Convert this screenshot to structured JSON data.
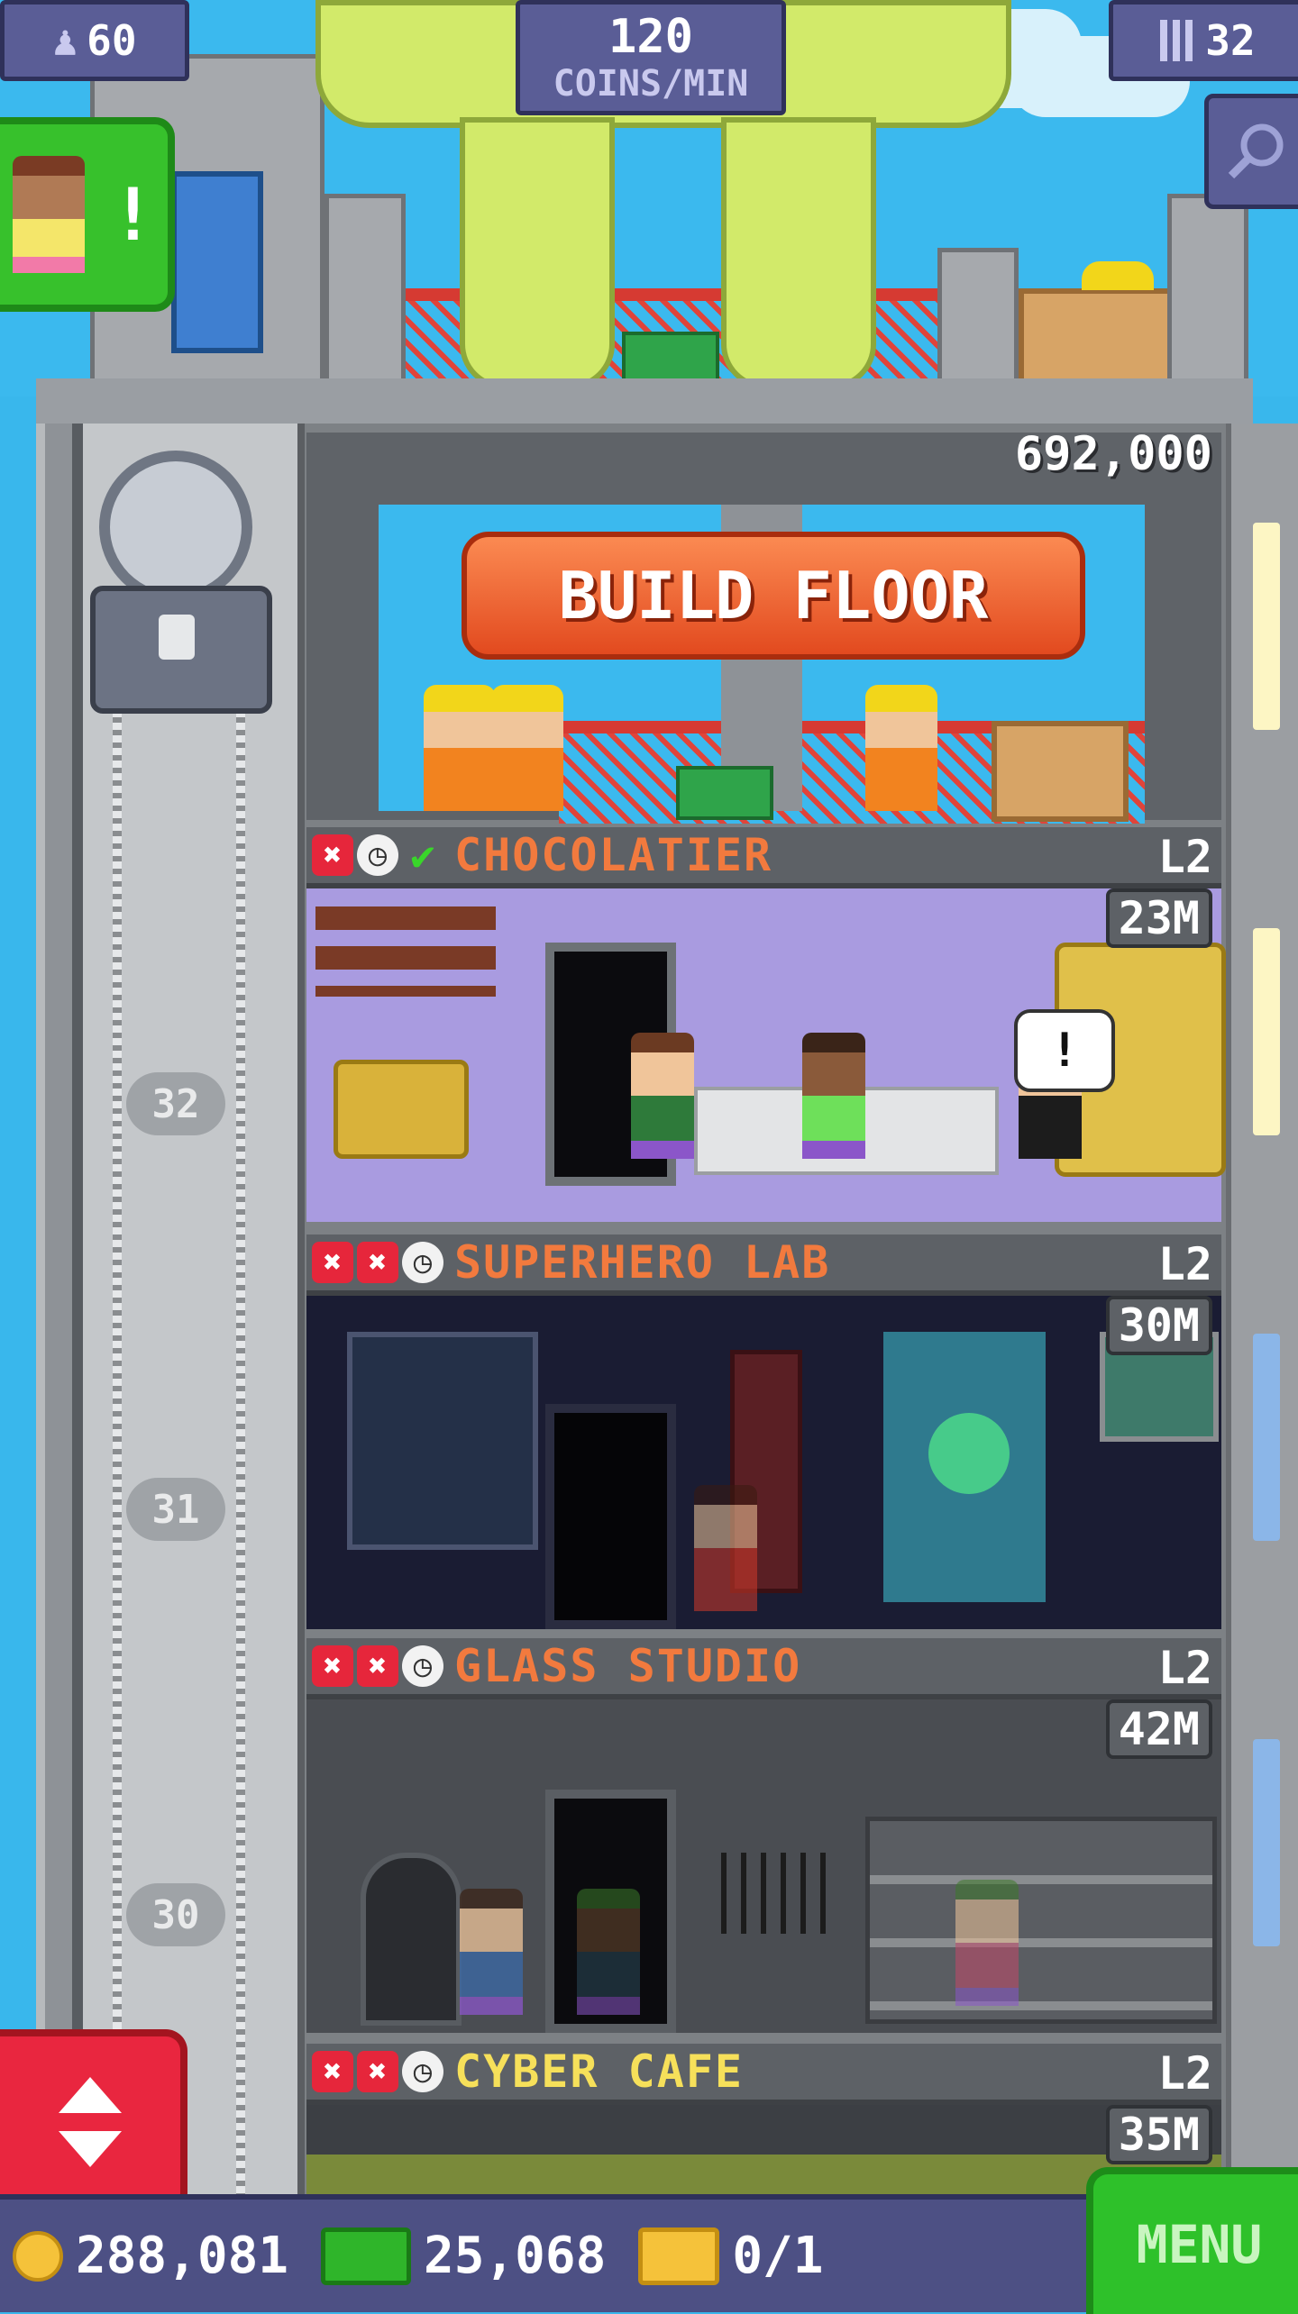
{
  "hud": {
    "population": "60",
    "coins_per_min_value": "120",
    "coins_per_min_label": "COINS/MIN",
    "floor_count": "32"
  },
  "build_floor": {
    "price": "692,000",
    "button_label": "BUILD FLOOR"
  },
  "floors": [
    {
      "name": "CHOCOLATIER",
      "level": "L2",
      "value": "23M",
      "status": [
        "x",
        "clock",
        "check"
      ]
    },
    {
      "name": "SUPERHERO LAB",
      "level": "L2",
      "value": "30M",
      "status": [
        "x",
        "x",
        "clock"
      ]
    },
    {
      "name": "GLASS STUDIO",
      "level": "L2",
      "value": "42M",
      "status": [
        "x",
        "x",
        "clock"
      ]
    },
    {
      "name": "CYBER CAFE",
      "level": "L2",
      "value": "35M",
      "status": [
        "x",
        "x",
        "clock"
      ]
    }
  ],
  "elevator_floor_numbers": [
    "32",
    "31",
    "30"
  ],
  "bottom_bar": {
    "coins": "288,081",
    "tower_bux": "25,068",
    "tickets": "0/1",
    "menu_label": "MENU"
  },
  "speech_bubble": "!",
  "visitor_alert": "!",
  "icons": {
    "population": "person-icon",
    "floors": "building-icon",
    "zoom": "magnifier-icon",
    "elevator_toggle": "up-down-arrows-icon",
    "coin": "coin-icon",
    "bux": "bux-icon",
    "ticket": "ticket-icon"
  },
  "colors": {
    "sky": "#3bb9ee",
    "hud": "#5a5d96",
    "build_button": "#e8592a",
    "menu_button": "#2ec12a",
    "elevator_button": "#e9263f",
    "floor_name_orange": "#f27a3e",
    "floor_name_yellow": "#f6e05a"
  }
}
